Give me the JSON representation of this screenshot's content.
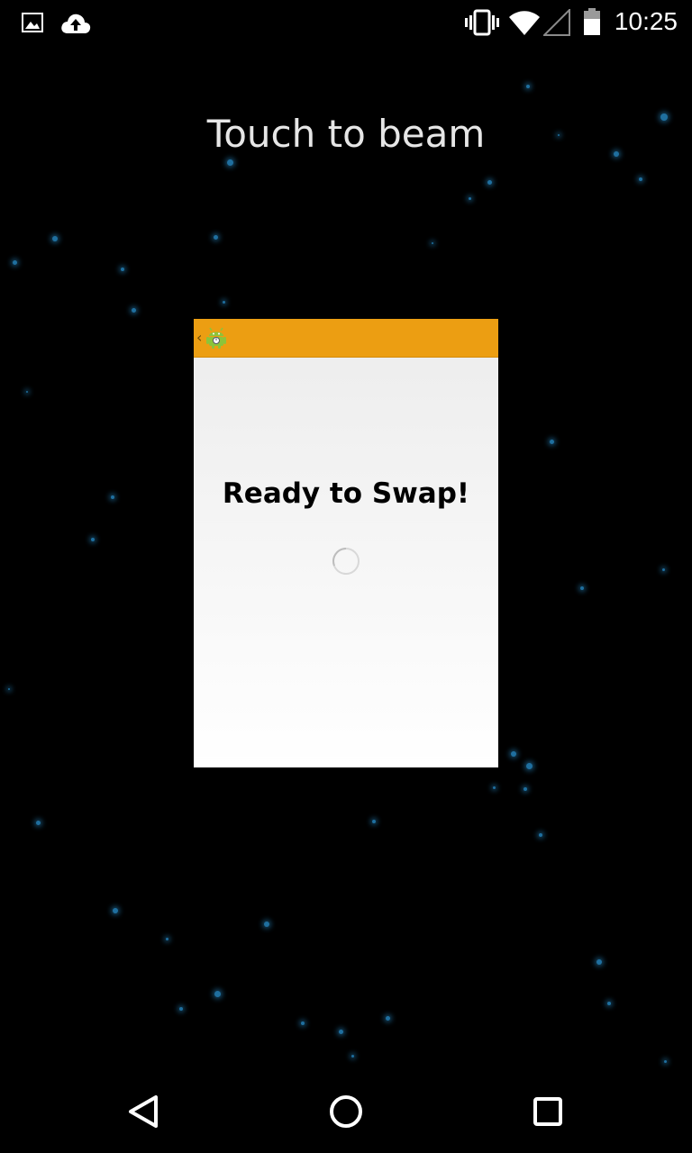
{
  "status_bar": {
    "time": "10:25",
    "icons": [
      "gallery-notification-icon",
      "cloud-upload-icon",
      "vibrate-icon",
      "wifi-icon",
      "cell-signal-icon",
      "battery-icon"
    ]
  },
  "beam": {
    "title": "Touch to beam"
  },
  "preview": {
    "heading": "Ready to Swap!",
    "actionbar_color": "#ec9e12",
    "back_glyph": "‹",
    "icons": [
      "android-app-icon",
      "loading-spinner-icon"
    ]
  },
  "nav_bar": {
    "icons": [
      "back-icon",
      "home-icon",
      "recents-icon"
    ]
  },
  "colors": {
    "background": "#000000",
    "star": "#1f6f9f",
    "accent": "#ec9e12"
  }
}
